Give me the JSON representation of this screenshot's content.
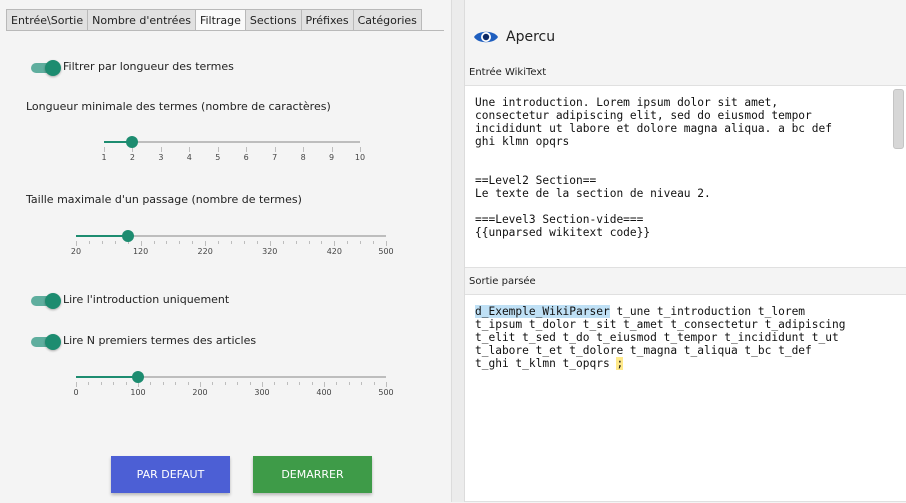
{
  "tabs": [
    {
      "label": "Entrée\\Sortie"
    },
    {
      "label": "Nombre d'entrées"
    },
    {
      "label": "Filtrage"
    },
    {
      "label": "Sections"
    },
    {
      "label": "Préfixes"
    },
    {
      "label": "Catégories"
    }
  ],
  "active_tab": "Filtrage",
  "filter": {
    "toggle_length_label": "Filtrer par longueur des termes",
    "toggle_length_on": true,
    "min_length_label": "Longueur minimale des termes (nombre de caractères)",
    "min_length": {
      "value": 2,
      "min": 1,
      "max": 10,
      "ticks": [
        "1",
        "2",
        "3",
        "4",
        "5",
        "6",
        "7",
        "8",
        "9",
        "10"
      ]
    },
    "max_passage_label": "Taille maximale d'un passage (nombre de termes)",
    "max_passage": {
      "value": 100,
      "min": 20,
      "max": 500,
      "ticks": [
        "20",
        "120",
        "220",
        "320",
        "420",
        "500"
      ]
    },
    "intro_only_label": "Lire l'introduction uniquement",
    "intro_only_on": true,
    "first_n_label": "Lire N premiers termes des articles",
    "first_n_on": true,
    "first_n": {
      "value": 100,
      "min": 0,
      "max": 500,
      "ticks": [
        "0",
        "100",
        "200",
        "300",
        "400",
        "500"
      ]
    }
  },
  "buttons": {
    "default_label": "PAR DEFAUT",
    "start_label": "DEMARRER"
  },
  "preview": {
    "title": "Apercu",
    "input_label": "Entrée WikiText",
    "input_text": "Une introduction. Lorem ipsum dolor sit amet,\nconsectetur adipiscing elit, sed do eiusmod tempor\nincididunt ut labore et dolore magna aliqua. a bc def\nghi klmn opqrs\n\n\n==Level2 Section==\nLe texte de la section de niveau 2.\n\n===Level3 Section-vide===\n{{unparsed wikitext code}}",
    "output_label": "Sortie parsée",
    "output_first_token": "d_Exemple_WikiParser",
    "output_line1_rest": " t_une t_introduction t_lorem",
    "output_rest": "t_ipsum t_dolor t_sit t_amet t_consectetur t_adipiscing\nt_elit t_sed t_do t_eiusmod t_tempor t_incididunt t_ut\nt_labore t_et t_dolore t_magna t_aliqua t_bc t_def\nt_ghi t_klmn t_opqrs ",
    "output_end": ";"
  },
  "colors": {
    "accent": "#1d8c70",
    "default_button": "#4c5fd5",
    "start_button": "#3e9b48"
  }
}
